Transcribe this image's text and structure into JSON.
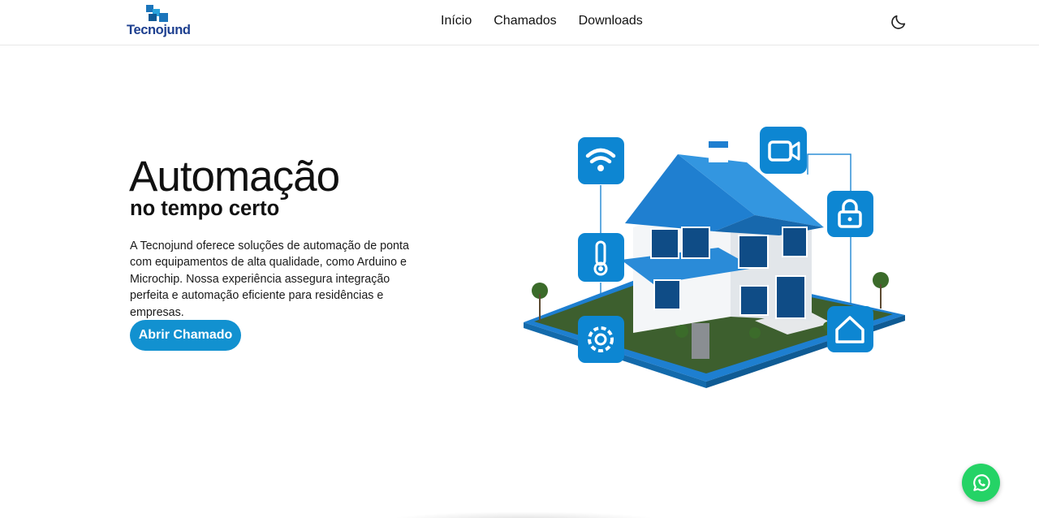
{
  "brand": {
    "name": "Tecnojund"
  },
  "nav": [
    {
      "label": "Início"
    },
    {
      "label": "Chamados"
    },
    {
      "label": "Downloads"
    }
  ],
  "theme_toggle": {
    "icon": "moon-icon"
  },
  "hero": {
    "title": "Automação",
    "subtitle": "no tempo certo",
    "description": "A Tecnojund oferece soluções de automação de ponta com equipamentos de alta qualidade, como Arduino e Microchip. Nossa experiência assegura integração perfeita e automação eficiente para residências e empresas.",
    "cta_label": "Abrir Chamado"
  },
  "illustration": {
    "icons": [
      "wifi-icon",
      "thermometer-icon",
      "gear-icon",
      "video-camera-icon",
      "lock-icon",
      "home-icon"
    ]
  },
  "whatsapp": {
    "icon": "whatsapp-icon"
  },
  "colors": {
    "accent": "#1291d0",
    "brand_text": "#1d3f8f",
    "whatsapp": "#25d366",
    "roof": "#1f7fd0"
  }
}
